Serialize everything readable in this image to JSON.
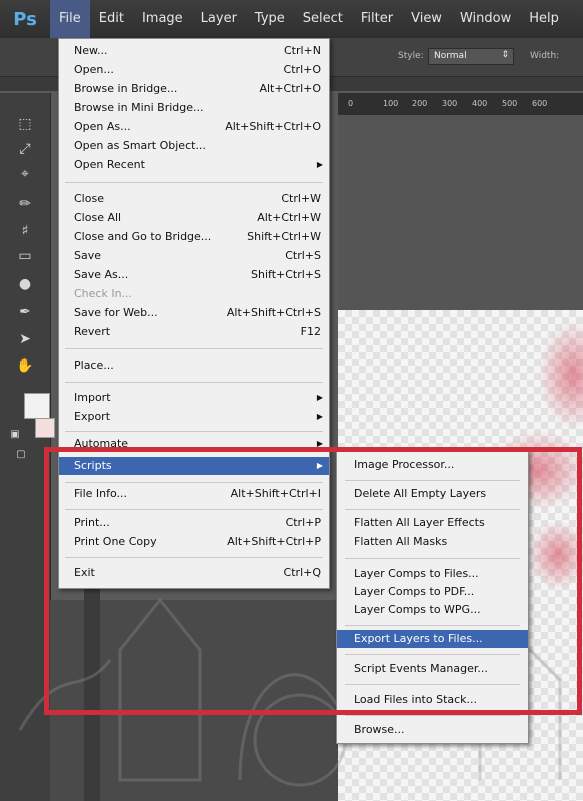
{
  "app": {
    "logo": "Ps"
  },
  "menubar": {
    "items": [
      "File",
      "Edit",
      "Image",
      "Layer",
      "Type",
      "Select",
      "Filter",
      "View",
      "Window",
      "Help"
    ]
  },
  "options_bar": {
    "style_label": "Style:",
    "style_value": "Normal",
    "width_label": "Width:"
  },
  "ruler": {
    "ticks": [
      "0",
      "100",
      "200",
      "300",
      "400",
      "500",
      "600"
    ]
  },
  "file_menu": {
    "groups": [
      [
        {
          "label": "New...",
          "shortcut": "Ctrl+N"
        },
        {
          "label": "Open...",
          "shortcut": "Ctrl+O"
        },
        {
          "label": "Browse in Bridge...",
          "shortcut": "Alt+Ctrl+O"
        },
        {
          "label": "Browse in Mini Bridge...",
          "shortcut": ""
        },
        {
          "label": "Open As...",
          "shortcut": "Alt+Shift+Ctrl+O"
        },
        {
          "label": "Open as Smart Object...",
          "shortcut": ""
        },
        {
          "label": "Open Recent",
          "shortcut": "",
          "submenu": true
        }
      ],
      [
        {
          "label": "Close",
          "shortcut": "Ctrl+W"
        },
        {
          "label": "Close All",
          "shortcut": "Alt+Ctrl+W"
        },
        {
          "label": "Close and Go to Bridge...",
          "shortcut": "Shift+Ctrl+W"
        },
        {
          "label": "Save",
          "shortcut": "Ctrl+S"
        },
        {
          "label": "Save As...",
          "shortcut": "Shift+Ctrl+S"
        },
        {
          "label": "Check In...",
          "shortcut": "",
          "disabled": true
        },
        {
          "label": "Save for Web...",
          "shortcut": "Alt+Shift+Ctrl+S"
        },
        {
          "label": "Revert",
          "shortcut": "F12"
        }
      ],
      [
        {
          "label": "Place...",
          "shortcut": ""
        }
      ],
      [
        {
          "label": "Import",
          "shortcut": "",
          "submenu": true
        },
        {
          "label": "Export",
          "shortcut": "",
          "submenu": true
        }
      ],
      [
        {
          "label": "Automate",
          "shortcut": "",
          "submenu": true
        },
        {
          "label": "Scripts",
          "shortcut": "",
          "submenu": true,
          "highlight": true
        }
      ],
      [
        {
          "label": "File Info...",
          "shortcut": "Alt+Shift+Ctrl+I"
        }
      ],
      [
        {
          "label": "Print...",
          "shortcut": "Ctrl+P"
        },
        {
          "label": "Print One Copy",
          "shortcut": "Alt+Shift+Ctrl+P"
        }
      ],
      [
        {
          "label": "Exit",
          "shortcut": "Ctrl+Q"
        }
      ]
    ]
  },
  "scripts_submenu": {
    "groups": [
      [
        {
          "label": "Image Processor..."
        }
      ],
      [
        {
          "label": "Delete All Empty Layers"
        }
      ],
      [
        {
          "label": "Flatten All Layer Effects"
        },
        {
          "label": "Flatten All Masks"
        }
      ],
      [
        {
          "label": "Layer Comps to Files..."
        },
        {
          "label": "Layer Comps to PDF..."
        },
        {
          "label": "Layer Comps to WPG..."
        }
      ],
      [
        {
          "label": "Export Layers to Files...",
          "highlight": true
        }
      ],
      [
        {
          "label": "Script Events Manager..."
        }
      ],
      [
        {
          "label": "Load Files into Stack..."
        }
      ],
      [
        {
          "label": "Browse..."
        }
      ]
    ]
  },
  "colors": {
    "highlight": "#3d66b0",
    "annotation_frame": "#cf2d3a",
    "menubar": "#333333"
  },
  "tools": [
    "marquee-icon",
    "lasso-icon",
    "crop-icon",
    "brush-icon",
    "stamp-icon",
    "eraser-icon",
    "dodge-icon",
    "pen-icon",
    "path-select-icon",
    "hand-icon"
  ]
}
